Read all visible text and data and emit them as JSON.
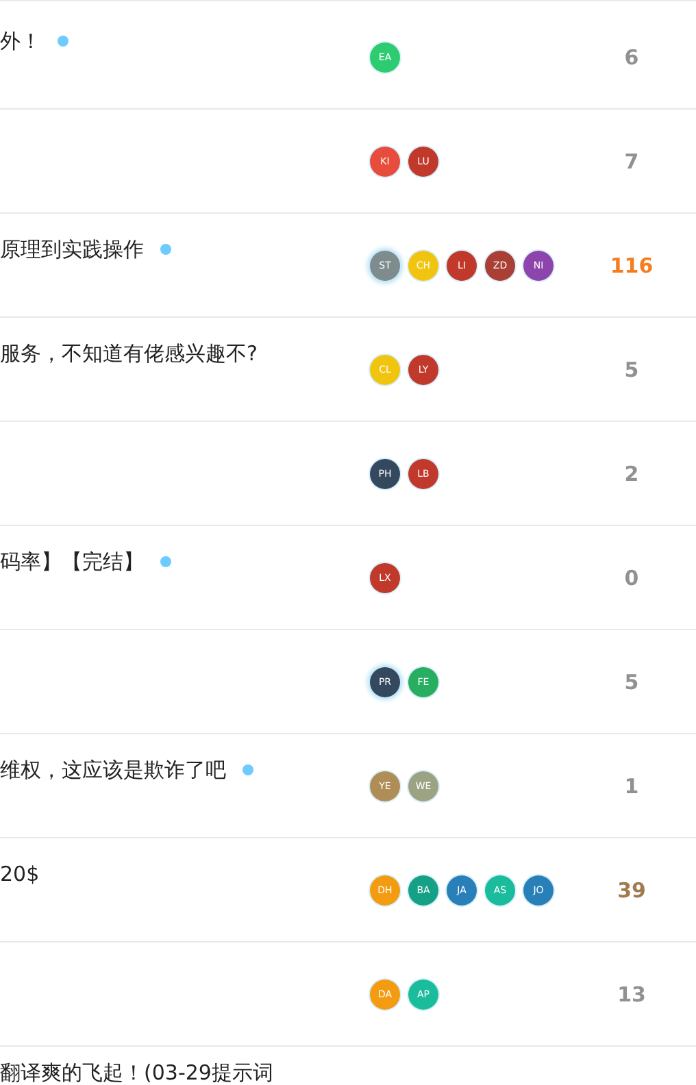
{
  "topics": [
    {
      "title": "外！",
      "unread": true,
      "posters": [
        {
          "initials": "EA",
          "color": "#2ecc71",
          "highlighted": false
        }
      ],
      "replies": "6",
      "color": "#919191"
    },
    {
      "posters": [
        {
          "initials": "KI",
          "color": "#e74c3c",
          "highlighted": false
        },
        {
          "initials": "LU",
          "color": "#c0392b",
          "highlighted": false
        }
      ],
      "replies": "7",
      "color": "#919191"
    },
    {
      "title": "原理到实践操作",
      "unread": true,
      "posters": [
        {
          "initials": "ST",
          "color": "#7f8c8d",
          "highlighted": true
        },
        {
          "initials": "CH",
          "color": "#f1c40f",
          "highlighted": false
        },
        {
          "initials": "LI",
          "color": "#c0392b",
          "highlighted": false
        },
        {
          "initials": "ZD",
          "color": "#a93f35",
          "highlighted": false
        },
        {
          "initials": "NI",
          "color": "#8e44ad",
          "highlighted": false
        }
      ],
      "replies": "116",
      "color": "#f57d20"
    },
    {
      "title": "服务，不知道有佬感兴趣不?",
      "unread": false,
      "posters": [
        {
          "initials": "CL",
          "color": "#f1c40f",
          "highlighted": false
        },
        {
          "initials": "LY",
          "color": "#c0392b",
          "highlighted": false
        }
      ],
      "replies": "5",
      "color": "#919191"
    },
    {
      "posters": [
        {
          "initials": "PH",
          "color": "#34495e",
          "highlighted": false
        },
        {
          "initials": "LB",
          "color": "#c0392b",
          "highlighted": false
        }
      ],
      "replies": "2",
      "color": "#919191"
    },
    {
      "title": "码率】【完结】",
      "unread": true,
      "posters": [
        {
          "initials": "LX",
          "color": "#c0392b",
          "highlighted": false
        }
      ],
      "replies": "0",
      "color": "#919191"
    },
    {
      "posters": [
        {
          "initials": "PR",
          "color": "#34495e",
          "highlighted": true
        },
        {
          "initials": "FE",
          "color": "#27ae60",
          "highlighted": false
        }
      ],
      "replies": "5",
      "color": "#919191"
    },
    {
      "title": "维权，这应该是欺诈了吧",
      "unread": true,
      "posters": [
        {
          "initials": "YE",
          "color": "#b08d57",
          "highlighted": false
        },
        {
          "initials": "WE",
          "color": "#9ca383",
          "highlighted": false
        }
      ],
      "replies": "1",
      "color": "#919191"
    },
    {
      "title": "20$",
      "unread": false,
      "posters": [
        {
          "initials": "DH",
          "color": "#f39c12",
          "highlighted": false
        },
        {
          "initials": "BA",
          "color": "#16a085",
          "highlighted": false
        },
        {
          "initials": "JA",
          "color": "#2980b9",
          "highlighted": false
        },
        {
          "initials": "AS",
          "color": "#1abc9c",
          "highlighted": false
        },
        {
          "initials": "JO",
          "color": "#2980b9",
          "highlighted": false
        }
      ],
      "replies": "39",
      "color": "#a27a4f"
    },
    {
      "posters": [
        {
          "initials": "DA",
          "color": "#f39c12",
          "highlighted": false
        },
        {
          "initials": "AP",
          "color": "#1abc9c",
          "highlighted": false
        }
      ],
      "replies": "13",
      "color": "#919191"
    },
    {
      "title": "翻译爽的飞起！(03-29提示词"
    }
  ]
}
